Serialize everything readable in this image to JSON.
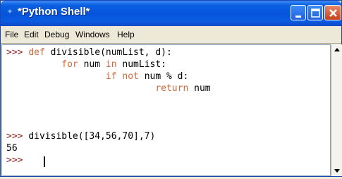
{
  "window": {
    "title": "*Python Shell*",
    "icon": "idle-icon"
  },
  "menu": [
    "File",
    "Edit",
    "Debug",
    "Windows",
    "Help"
  ],
  "shell": {
    "line1": {
      "prompt": ">>>",
      "kw": "def",
      "rest": "divisible(numList, d):"
    },
    "line2": {
      "kw1": "for",
      "mid1": "num",
      "kw2": "in",
      "rest": "numList:"
    },
    "line3": {
      "kw1": "if",
      "kw2": "not",
      "rest": "num % d:"
    },
    "line4": {
      "kw": "return",
      "rest": "num"
    },
    "line5": {
      "prompt": ">>>",
      "rest": "divisible([34,56,70],7)"
    },
    "output": "56",
    "prompt_last": ">>>"
  }
}
